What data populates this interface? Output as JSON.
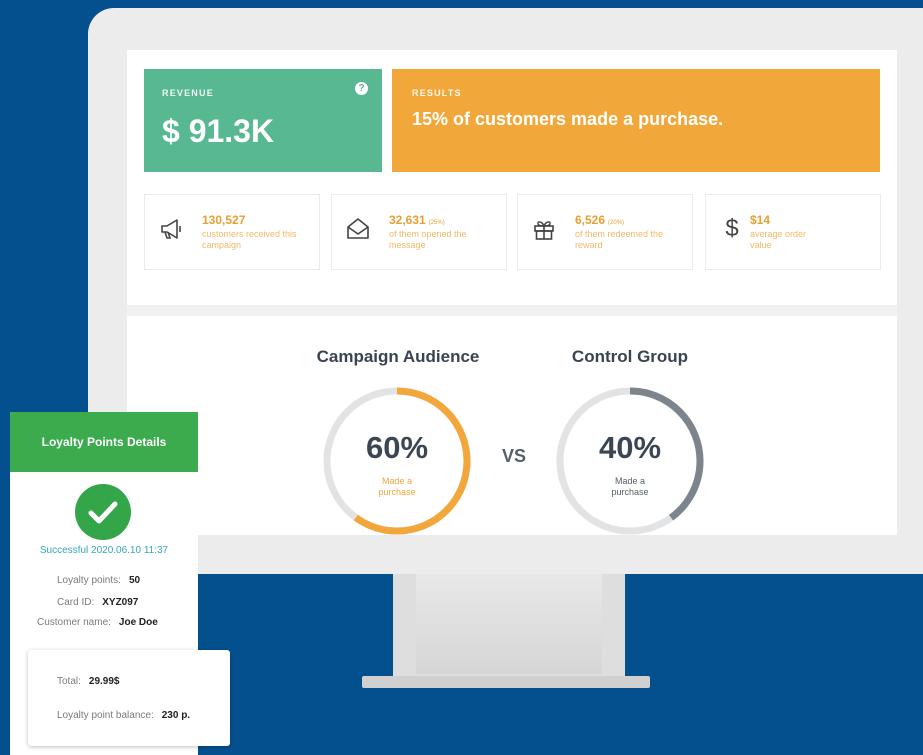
{
  "dashboard": {
    "revenue": {
      "label": "REVENUE",
      "value": "$ 91.3K",
      "help_glyph": "?"
    },
    "results": {
      "label": "RESULTS",
      "text": "15% of customers made a purchase."
    },
    "stats": [
      {
        "icon": "megaphone-icon",
        "value": "130,527",
        "percent": "",
        "desc": "customers received this campaign"
      },
      {
        "icon": "envelope-open-icon",
        "value": "32,631",
        "percent": "(25%)",
        "desc": "of them opened the message"
      },
      {
        "icon": "gift-icon",
        "value": "6,526",
        "percent": "(20%)",
        "desc": "of them redeemed the reward"
      },
      {
        "icon": "dollar-icon",
        "value": "$14",
        "percent": "",
        "desc": "average order value"
      }
    ],
    "comparison": {
      "audience": {
        "title": "Campaign Audience",
        "value": "60%",
        "caption": "Made a purchase",
        "fraction": 0.6,
        "color": "#f2a73b"
      },
      "vs": "VS",
      "control": {
        "title": "Control Group",
        "value": "40%",
        "caption": "Made a purchase",
        "fraction": 0.4,
        "color": "#7d848c"
      }
    }
  },
  "loyalty": {
    "title": "Loyalty Points Details",
    "status": "Successful 2020.06.10 11:37",
    "points_label": "Loyalty points:",
    "points_value": "50",
    "card_label": "Card ID:",
    "card_value": "XYZ097",
    "customer_label": "Customer name:",
    "customer_value": "Joe Doe",
    "total_label": "Total:",
    "total_value": "29.99$",
    "balance_label": "Loyalty point balance:",
    "balance_value": "230 p."
  },
  "colors": {
    "background": "#04508f",
    "green": "#57b891",
    "orange": "#f2a73b",
    "receipt_green": "#3bab4e"
  }
}
